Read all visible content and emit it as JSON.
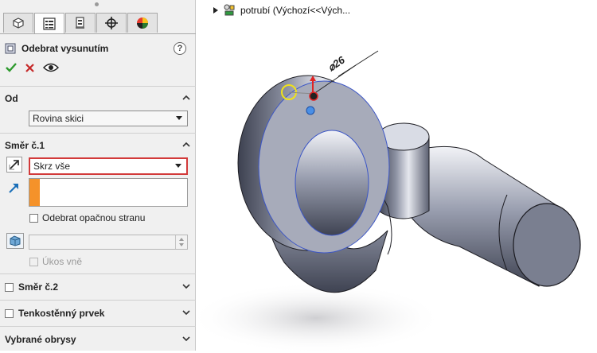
{
  "feature": {
    "title": "Odebrat vysunutím",
    "help": "?"
  },
  "sections": {
    "from": {
      "title": "Od",
      "value": "Rovina skici"
    },
    "dir1": {
      "title": "Směr č.1",
      "end_condition": "Skrz vše",
      "flip_side_label": "Odebrat opačnou stranu",
      "draft_label": "Úkos vně"
    },
    "dir2": {
      "title": "Směr č.2"
    },
    "thin": {
      "title": "Tenkostěnný prvek"
    },
    "contours": {
      "title": "Vybrané obrysy"
    }
  },
  "tree": {
    "label": "potrubí  (Výchozí<<Vých..."
  },
  "dimension": {
    "label": "⌀26"
  },
  "colors": {
    "highlight_border": "#d23a3a",
    "accent_bar": "#f5922a",
    "ok_green": "#2e9a2e",
    "cancel_red": "#c62828"
  }
}
